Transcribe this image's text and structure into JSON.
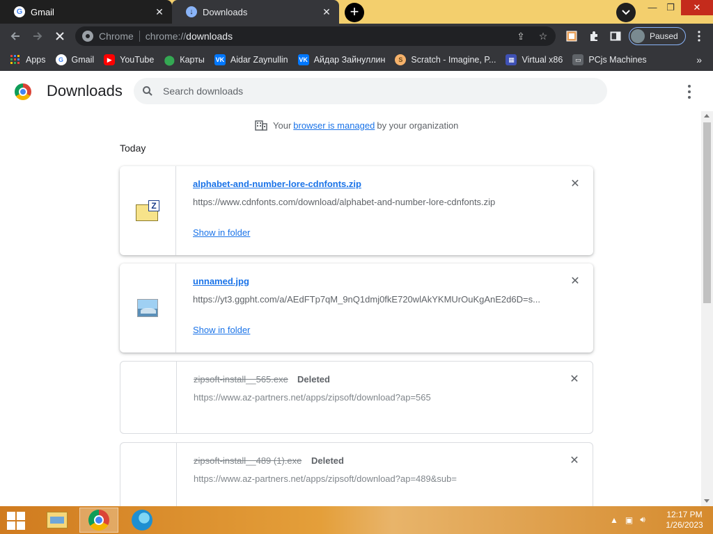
{
  "tabs": [
    {
      "title": "Gmail",
      "close": "✕"
    },
    {
      "title": "Downloads",
      "close": "✕"
    }
  ],
  "new_tab": "+",
  "window_controls": {
    "minimize": "—",
    "maximize": "❐",
    "close": "✕"
  },
  "toolbar": {
    "site_chip": "Chrome",
    "url_scheme": "chrome://",
    "url_host": "downloads",
    "profile_status": "Paused"
  },
  "bookmarks": [
    {
      "label": "Apps",
      "icon": "apps-grid-icon",
      "color": "#4285f4"
    },
    {
      "label": "Gmail",
      "icon": "google-icon",
      "color": "#ffffff"
    },
    {
      "label": "YouTube",
      "icon": "youtube-icon",
      "color": "#ff0000"
    },
    {
      "label": "Карты",
      "icon": "maps-icon",
      "color": "#34a853"
    },
    {
      "label": "Aidar Zaynullin",
      "icon": "vk-icon",
      "color": "#0077ff"
    },
    {
      "label": "Айдар Зайнуллин",
      "icon": "vk-icon",
      "color": "#0077ff"
    },
    {
      "label": "Scratch - Imagine, P...",
      "icon": "scratch-icon",
      "color": "#f6b26b"
    },
    {
      "label": "Virtual x86",
      "icon": "virtual-x86-icon",
      "color": "#3f51b5"
    },
    {
      "label": "PCjs Machines",
      "icon": "pcjs-icon",
      "color": "#5f6368"
    }
  ],
  "bookmarks_more": "»",
  "page": {
    "title": "Downloads",
    "search_placeholder": "Search downloads",
    "managed_prefix": "Your",
    "managed_link": "browser is managed",
    "managed_suffix": "by your organization",
    "section_today": "Today"
  },
  "downloads": [
    {
      "filename": "alphabet-and-number-lore-cdnfonts.zip",
      "url": "https://www.cdnfonts.com/download/alphabet-and-number-lore-cdnfonts.zip",
      "action": "Show in folder",
      "icon": "zip-file-icon"
    },
    {
      "filename": "unnamed.jpg",
      "url": "https://yt3.ggpht.com/a/AEdFTp7qM_9nQ1dmj0fkE720wlAkYKMUrOuKgAnE2d6D=s...",
      "action": "Show in folder",
      "icon": "image-file-icon"
    },
    {
      "filename": "zipsoft-install__565.exe",
      "status": "Deleted",
      "url": "https://www.az-partners.net/apps/zipsoft/download?ap=565"
    },
    {
      "filename": "zipsoft-install__489 (1).exe",
      "status": "Deleted",
      "url": "https://www.az-partners.net/apps/zipsoft/download?ap=489&sub="
    }
  ],
  "taskbar": {
    "apps": [
      "file-explorer-icon",
      "chrome-icon",
      "edge-icon"
    ],
    "time": "12:17 PM",
    "date": "1/26/2023"
  }
}
